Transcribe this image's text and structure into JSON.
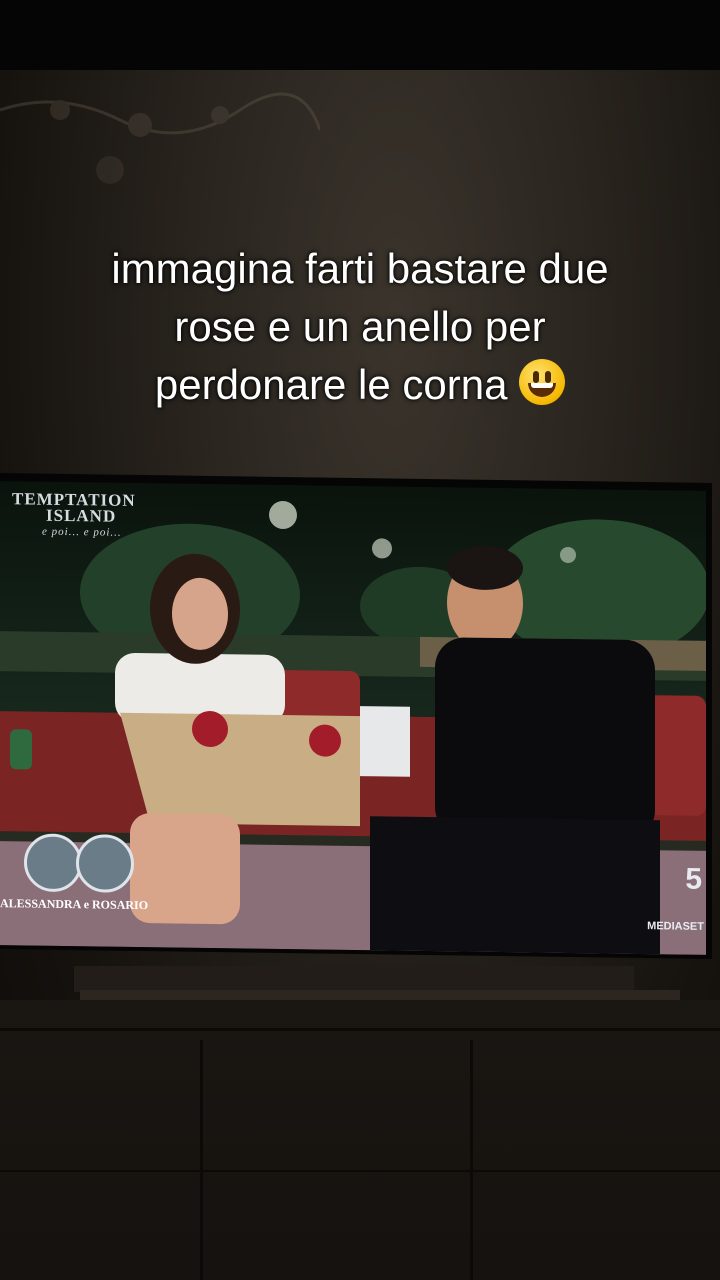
{
  "caption": {
    "line1": "immagina farti bastare due",
    "line2": "rose e un anello per",
    "line3": "perdonare le corna",
    "emoji": "grinning-face-emoji"
  },
  "tv": {
    "show_logo_line1": "TEMPTATION",
    "show_logo_line2": "ISLAND",
    "show_logo_sub": "e poi... e poi...",
    "couple_names": "ALESSANDRA e ROSARIO",
    "channel_number": "5",
    "channel_name": "MEDIASET"
  },
  "colors": {
    "caption_text": "#ffffff",
    "sofa_red": "#8e2a2a",
    "shirt_black": "#0b0b0d"
  }
}
